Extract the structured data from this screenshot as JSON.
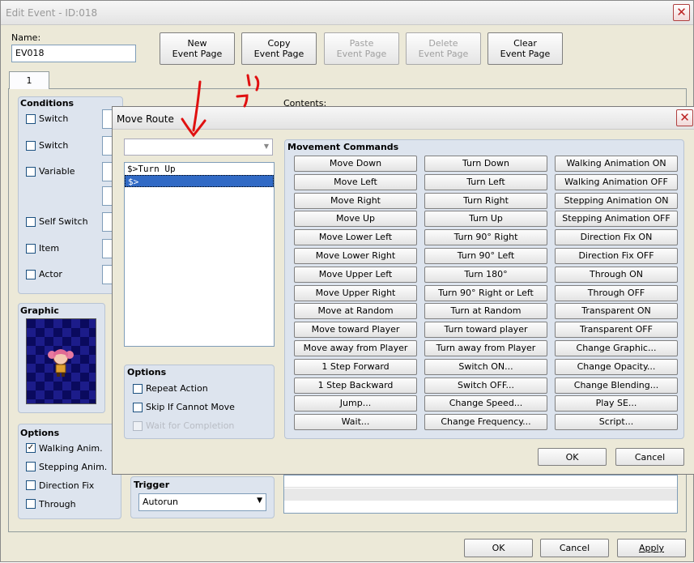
{
  "main": {
    "title": "Edit Event - ID:018",
    "name_label": "Name:",
    "name_value": "EV018",
    "buttons": [
      {
        "l1": "New",
        "l2": "Event Page"
      },
      {
        "l1": "Copy",
        "l2": "Event Page"
      },
      {
        "l1": "Paste",
        "l2": "Event Page"
      },
      {
        "l1": "Delete",
        "l2": "Event Page"
      },
      {
        "l1": "Clear",
        "l2": "Event Page"
      }
    ],
    "tab": "1",
    "conditions_label": "Conditions",
    "conditions": [
      "Switch",
      "Switch",
      "Variable",
      "Self Switch",
      "Item",
      "Actor"
    ],
    "contents_label": "Contents:",
    "graphic_label": "Graphic",
    "options_label": "Options",
    "options": [
      {
        "label": "Walking Anim.",
        "checked": true
      },
      {
        "label": "Stepping Anim.",
        "checked": false
      },
      {
        "label": "Direction Fix",
        "checked": false
      },
      {
        "label": "Through",
        "checked": false
      }
    ],
    "trigger_label": "Trigger",
    "trigger_value": "Autorun",
    "ok": "OK",
    "cancel": "Cancel",
    "apply": "Apply"
  },
  "move_route": {
    "title": "Move Route",
    "list": [
      "$>Turn Up",
      "$>"
    ],
    "options_label": "Options",
    "options": [
      {
        "label": "Repeat Action",
        "disabled": false
      },
      {
        "label": "Skip If Cannot Move",
        "disabled": false
      },
      {
        "label": "Wait for Completion",
        "disabled": true
      }
    ],
    "commands_label": "Movement Commands",
    "col1": [
      "Move Down",
      "Move Left",
      "Move Right",
      "Move Up",
      "Move Lower Left",
      "Move Lower Right",
      "Move Upper Left",
      "Move Upper Right",
      "Move at Random",
      "Move toward Player",
      "Move away from Player",
      "1 Step Forward",
      "1 Step Backward",
      "Jump...",
      "Wait..."
    ],
    "col2": [
      "Turn Down",
      "Turn Left",
      "Turn Right",
      "Turn Up",
      "Turn 90° Right",
      "Turn 90° Left",
      "Turn 180°",
      "Turn 90° Right or Left",
      "Turn at Random",
      "Turn toward player",
      "Turn away from Player",
      "Switch ON...",
      "Switch OFF...",
      "Change Speed...",
      "Change Frequency..."
    ],
    "col3": [
      "Walking Animation ON",
      "Walking Animation OFF",
      "Stepping Animation ON",
      "Stepping Animation OFF",
      "Direction Fix ON",
      "Direction Fix OFF",
      "Through ON",
      "Through OFF",
      "Transparent ON",
      "Transparent OFF",
      "Change Graphic...",
      "Change Opacity...",
      "Change Blending...",
      "Play SE...",
      "Script..."
    ],
    "ok": "OK",
    "cancel": "Cancel"
  },
  "colors": {
    "annotation": "#e01010",
    "selection": "#316ac5"
  }
}
